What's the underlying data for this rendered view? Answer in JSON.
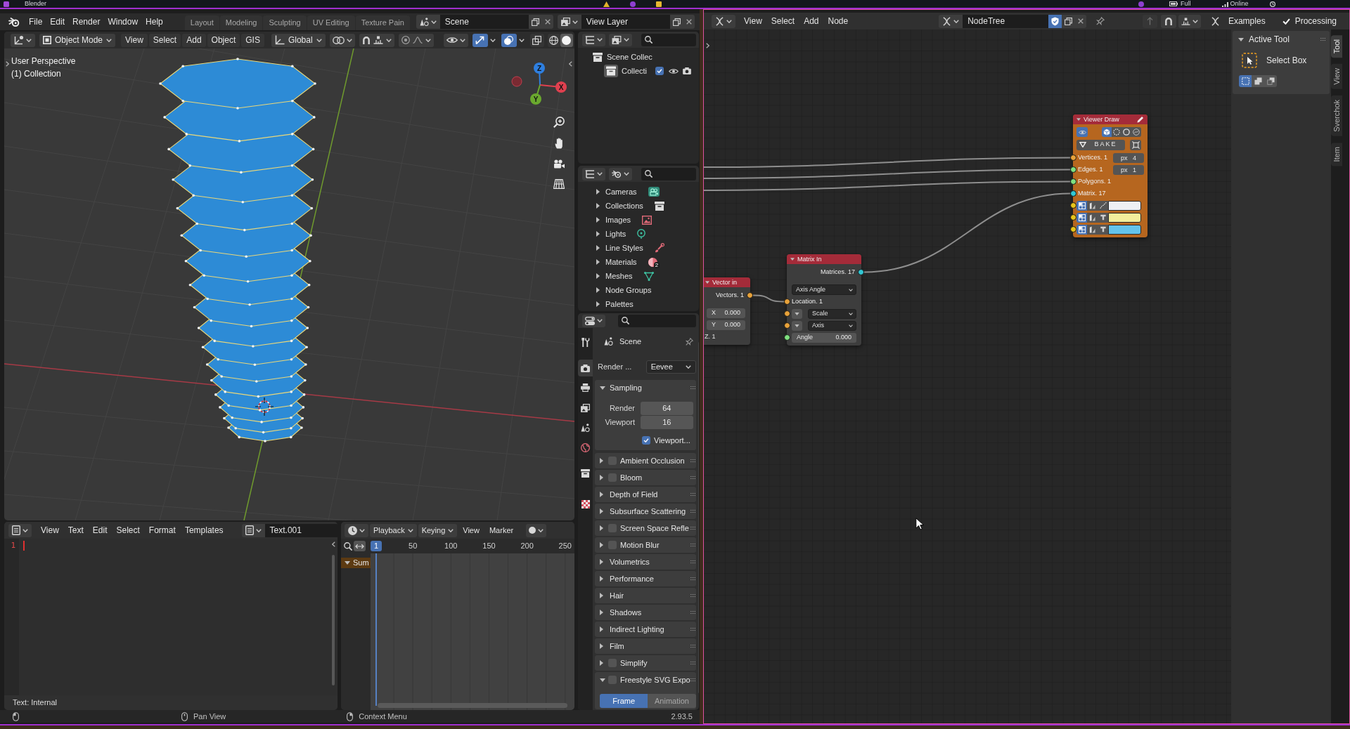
{
  "system_bar": {
    "title": "Blender",
    "battery": "Full",
    "network": "Online"
  },
  "topbar": {
    "menus": [
      "File",
      "Edit",
      "Render",
      "Window",
      "Help"
    ],
    "workspaces": [
      {
        "label": "Layout",
        "selected": false
      },
      {
        "label": "Modeling",
        "selected": false
      },
      {
        "label": "Sculpting",
        "selected": false
      },
      {
        "label": "UV Editing",
        "selected": false
      },
      {
        "label": "Texture Pain",
        "selected": false
      }
    ],
    "scene": "Scene",
    "view_layer": "View Layer"
  },
  "viewport": {
    "mode": "Object Mode",
    "menus": [
      "View",
      "Select",
      "Add",
      "Object",
      "GIS"
    ],
    "orientation": "Global",
    "gizmos_on": true,
    "overlays_on": true,
    "shading": [
      {
        "selected": false
      },
      {
        "selected": true
      }
    ],
    "info": [
      "User Perspective",
      "(1) Collection"
    ],
    "gizmo_axes": [
      "Z",
      "X",
      "Y"
    ]
  },
  "outliner": {
    "items": [
      {
        "label": "Scene Collec",
        "children": [
          {
            "label": "Collecti",
            "checked": true
          }
        ]
      }
    ]
  },
  "data_browser": {
    "items": [
      {
        "label": "Cameras",
        "kind": "camera",
        "expanded": false
      },
      {
        "label": "Collections",
        "kind": "collection",
        "expanded": false
      },
      {
        "label": "Images",
        "kind": "image",
        "expanded": false
      },
      {
        "label": "Lights",
        "kind": "light",
        "expanded": false
      },
      {
        "label": "Line Styles",
        "kind": "line_style",
        "expanded": false
      },
      {
        "label": "Materials",
        "kind": "material",
        "badge": "2",
        "expanded": false
      },
      {
        "label": "Meshes",
        "kind": "mesh",
        "expanded": false
      },
      {
        "label": "Node Groups",
        "kind": "plain",
        "expanded": false
      },
      {
        "label": "Palettes",
        "kind": "plain",
        "expanded": false
      }
    ]
  },
  "properties": {
    "tabs": [
      {
        "kind": "tool",
        "selected": false
      },
      {
        "kind": "render",
        "selected": true
      },
      {
        "kind": "output",
        "selected": false
      },
      {
        "kind": "view_layer",
        "selected": false
      },
      {
        "kind": "scene",
        "selected": false
      },
      {
        "kind": "world",
        "selected": false
      },
      {
        "kind": "collection",
        "selected": false
      },
      {
        "kind": "texture",
        "selected": false
      }
    ],
    "context": "Scene",
    "engine_label": "Render ...",
    "engine": "Eevee",
    "panels": [
      {
        "label": "Sampling",
        "expanded": true,
        "fields": [
          {
            "label": "Render",
            "value": "64"
          },
          {
            "label": "Viewport",
            "value": "16"
          }
        ],
        "option": {
          "label": "Viewport...",
          "checked": true
        }
      },
      {
        "label": "Ambient Occlusion",
        "expanded": false,
        "checked": false
      },
      {
        "label": "Bloom",
        "expanded": false,
        "checked": false
      },
      {
        "label": "Depth of Field",
        "expanded": false
      },
      {
        "label": "Subsurface Scattering",
        "expanded": false
      },
      {
        "label": "Screen Space Refle",
        "expanded": false,
        "checked": false
      },
      {
        "label": "Motion Blur",
        "expanded": false,
        "checked": false
      },
      {
        "label": "Volumetrics",
        "expanded": false
      },
      {
        "label": "Performance",
        "expanded": false
      },
      {
        "label": "Hair",
        "expanded": false
      },
      {
        "label": "Shadows",
        "expanded": false
      },
      {
        "label": "Indirect Lighting",
        "expanded": false
      },
      {
        "label": "Film",
        "expanded": false
      },
      {
        "label": "Simplify",
        "expanded": false,
        "checked": false
      },
      {
        "label": "Freestyle SVG Expo",
        "expanded": true,
        "checked": false,
        "buttons": [
          {
            "label": "Frame",
            "selected": true
          },
          {
            "label": "Animation",
            "selected": false
          }
        ]
      }
    ]
  },
  "text_editor": {
    "menus": [
      "View",
      "Text",
      "Edit",
      "Select",
      "Format",
      "Templates"
    ],
    "text_name": "Text.001",
    "line_numbers": [
      "1"
    ],
    "footer": "Text: Internal"
  },
  "timeline": {
    "menus": [
      {
        "label": "Playback",
        "kind": "dropdown"
      },
      {
        "label": "Keying",
        "kind": "dropdown"
      },
      {
        "label": "View",
        "kind": "menu"
      },
      {
        "label": "Marker",
        "kind": "menu"
      }
    ],
    "auto_keying": false,
    "current_frame": "1",
    "frame_ticks": [
      "50",
      "100",
      "150",
      "200",
      "250"
    ],
    "channels": [
      {
        "label": "Sum",
        "expanded": true
      }
    ]
  },
  "status_bar": {
    "hints": [
      {
        "label": "Pan View"
      },
      {
        "label": "Context Menu"
      }
    ],
    "version": "2.93.5"
  },
  "node_editor": {
    "menus": [
      "View",
      "Select",
      "Add",
      "Node"
    ],
    "tree": "NodeTree",
    "fake_user": true,
    "examples": "Examples",
    "processing": {
      "label": "Processing",
      "checked": true
    },
    "sidebar": {
      "panel": {
        "label": "Active Tool",
        "expanded": true
      },
      "tool": "Select Box",
      "modes": [
        {
          "selected": true
        },
        {
          "selected": false
        },
        {
          "selected": false
        }
      ],
      "tabs": [
        {
          "label": "Tool",
          "selected": true
        },
        {
          "label": "View",
          "selected": false
        },
        {
          "label": "Sverchok",
          "selected": false
        },
        {
          "label": "Item",
          "selected": false
        }
      ]
    },
    "nodes": [
      {
        "title": "Vector in",
        "kind": "input",
        "color": "#3d3d3d",
        "expanded": true,
        "rows": [
          {
            "kind": "output",
            "label": "Vectors. 1",
            "socket": {
              "color": "#e8a23a"
            }
          },
          {
            "kind": "number",
            "label": "X",
            "value": "0.000"
          },
          {
            "kind": "number",
            "label": "Y",
            "value": "0.000"
          },
          {
            "kind": "text",
            "label": "Z. 1"
          }
        ]
      },
      {
        "title": "Matrix In",
        "kind": "matrix",
        "color": "#3d3d3d",
        "expanded": true,
        "rows": [
          {
            "kind": "output",
            "label": "Matrices. 17",
            "socket": {
              "color": "#31c7d4"
            }
          },
          {
            "kind": "dropdown",
            "value": "Axis Angle"
          },
          {
            "kind": "input",
            "label": "Location. 1",
            "socket": {
              "color": "#e8a23a"
            }
          },
          {
            "kind": "input_dropdown",
            "value": "Scale",
            "socket": {
              "color": "#e8a23a"
            }
          },
          {
            "kind": "input_dropdown",
            "value": "Axis",
            "socket": {
              "color": "#e8a23a"
            }
          },
          {
            "kind": "number",
            "label": "Angle",
            "value": "0.000",
            "socket": {
              "color": "#7fe07f"
            }
          }
        ]
      },
      {
        "title": "Viewer Draw",
        "kind": "viewer",
        "color": "#b6661f",
        "expanded": true,
        "rows": [
          {
            "kind": "display",
            "on": true,
            "modes": [
              {
                "selected": true
              },
              {
                "selected": false
              },
              {
                "selected": false
              },
              {
                "selected": false
              }
            ]
          },
          {
            "kind": "bake",
            "label": "BAKE"
          },
          {
            "kind": "input",
            "label": "Vertices. 1",
            "value": "px 4",
            "socket": {
              "color": "#e8a23a"
            }
          },
          {
            "kind": "input",
            "label": "Edges. 1",
            "value": "px 1",
            "socket": {
              "color": "#7fe07f"
            }
          },
          {
            "kind": "input",
            "label": "Polygons. 1",
            "socket": {
              "color": "#7fe07f"
            }
          },
          {
            "kind": "input",
            "label": "Matrix. 17",
            "socket": {
              "color": "#31c7d4"
            }
          },
          {
            "kind": "color",
            "color": "#eef0f4",
            "socket": {
              "color": "#e8c41a"
            }
          },
          {
            "kind": "color",
            "color": "#f3ee9c",
            "socket": {
              "color": "#e8c41a"
            }
          },
          {
            "kind": "color",
            "color": "#64c3ea",
            "socket": {
              "color": "#e8c41a"
            }
          }
        ]
      }
    ]
  }
}
